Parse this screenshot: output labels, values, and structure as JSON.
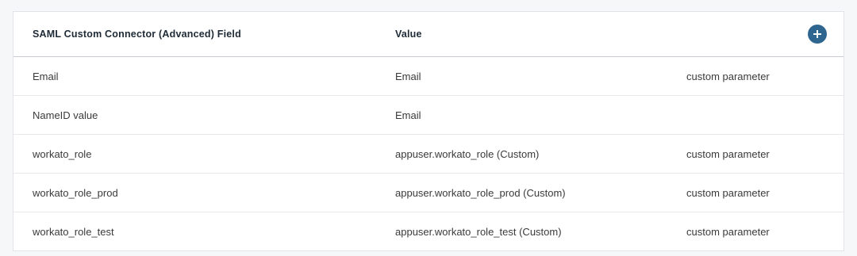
{
  "table": {
    "headers": {
      "field": "SAML Custom Connector (Advanced) Field",
      "value": "Value"
    },
    "add_icon": "plus-circle-icon",
    "accent_color": "#2f6690",
    "rows": [
      {
        "field": "Email",
        "value": "Email",
        "note": "custom parameter"
      },
      {
        "field": "NameID value",
        "value": "Email",
        "note": ""
      },
      {
        "field": "workato_role",
        "value": "appuser.workato_role (Custom)",
        "note": "custom parameter"
      },
      {
        "field": "workato_role_prod",
        "value": "appuser.workato_role_prod (Custom)",
        "note": "custom parameter"
      },
      {
        "field": "workato_role_test",
        "value": "appuser.workato_role_test (Custom)",
        "note": "custom parameter"
      }
    ]
  }
}
